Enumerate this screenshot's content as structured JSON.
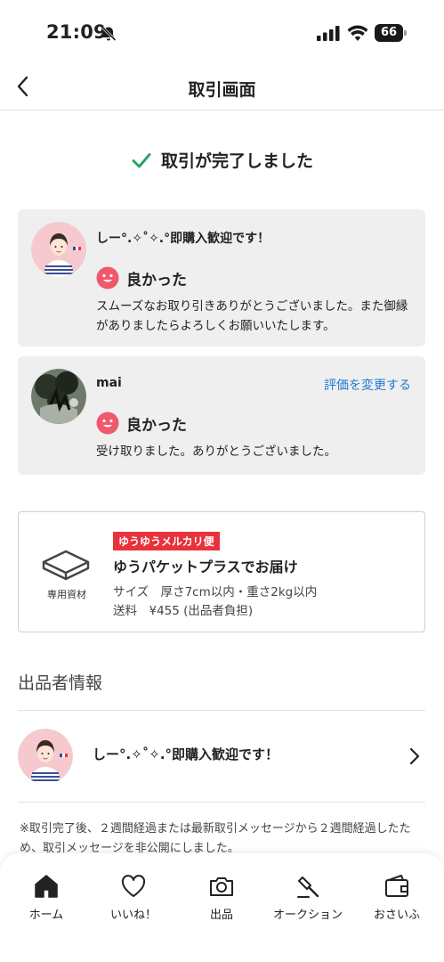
{
  "status_bar": {
    "time": "21:09",
    "battery": "66"
  },
  "header": {
    "title": "取引画面"
  },
  "complete": {
    "text": "取引が完了しました",
    "color": "#2aa56a"
  },
  "reviews": [
    {
      "name": "しー°.✧˚✧.°即購入歓迎です！",
      "rating": "良かった",
      "comment": "スムーズなお取り引きありがとうございました。また御縁がありましたらよろしくお願いいたします。"
    },
    {
      "name": "mai",
      "rating": "良かった",
      "comment": "受け取りました。ありがとうございました。",
      "change_link": "評価を変更する"
    }
  ],
  "shipping": {
    "package_label": "専用資材",
    "badge": "ゆうゆうメルカリ便",
    "method": "ゆうパケットプラスでお届け",
    "size": "サイズ　厚さ7cm以内・重さ2kg以内",
    "fee": "送料　¥455 (出品者負担)"
  },
  "seller": {
    "section_title": "出品者情報",
    "name": "しー°.✧˚✧.°即購入歓迎です！"
  },
  "notice": "※取引完了後、２週間経過または最新取引メッセージから２週間経過したため、取引メッセージを非公開にしました。",
  "nav": {
    "home": "ホーム",
    "like": "いいね！",
    "sell": "出品",
    "auction": "オークション",
    "wallet": "おさいふ"
  },
  "colors": {
    "accent_red": "#e8323c",
    "link_blue": "#1f7ad1",
    "smile_pink": "#f0586c"
  }
}
